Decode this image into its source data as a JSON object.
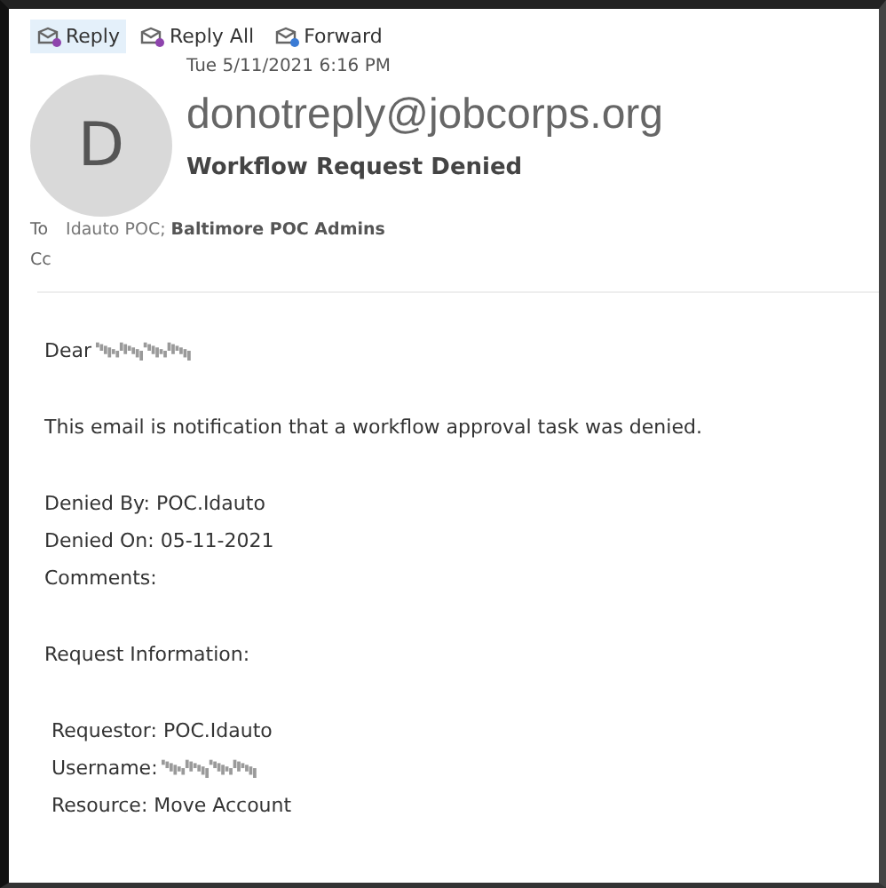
{
  "toolbar": [
    {
      "label": "Reply",
      "selected": true
    },
    {
      "label": "Reply All",
      "selected": false
    },
    {
      "label": "Forward",
      "selected": false
    }
  ],
  "message": {
    "date": "Tue 5/11/2021 6:16 PM",
    "avatar_letter": "D",
    "sender": "donotreply@jobcorps.org",
    "subject": "Workflow Request Denied",
    "to_label": "To",
    "recipients": [
      {
        "name": "Idauto POC;",
        "bold": false
      },
      {
        "name": "Baltimore POC Admins",
        "bold": true
      }
    ],
    "cc_label": "Cc"
  },
  "body": [
    {
      "kind": "redacted_line",
      "text": "Dear",
      "redacted": true
    },
    {
      "kind": "paragraph",
      "text": "This email is notification that a workflow approval task was denied."
    },
    {
      "kind": "lines",
      "lines": [
        {
          "text": "Denied By: POC.Idauto",
          "redacted": false
        },
        {
          "text": "Denied On: 05-11-2021",
          "redacted": false
        },
        {
          "text": "Comments:",
          "redacted": false
        }
      ]
    },
    {
      "kind": "paragraph",
      "text": "Request Information:"
    },
    {
      "kind": "lines",
      "indent": true,
      "lines": [
        {
          "text": "Requestor: POC.Idauto",
          "redacted": false
        },
        {
          "text": "Username:",
          "redacted": true
        },
        {
          "text": "Resource: Move Account",
          "redacted": false
        }
      ]
    }
  ]
}
